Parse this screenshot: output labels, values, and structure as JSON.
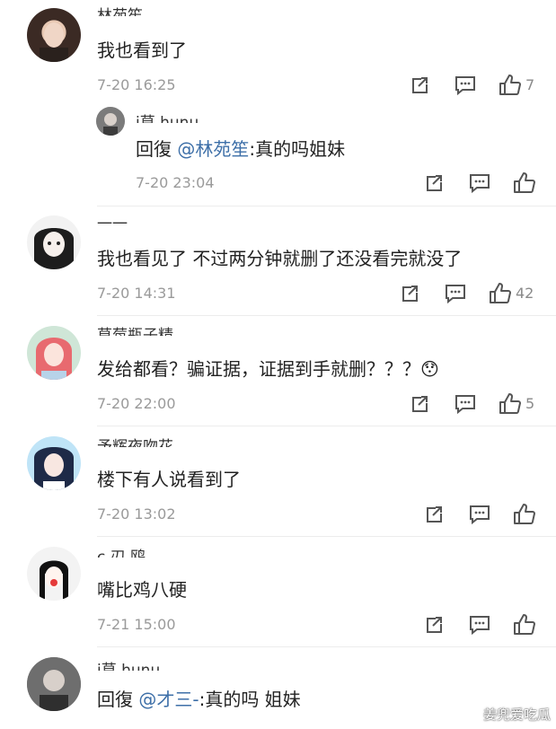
{
  "comments": [
    {
      "name": "林苑笙",
      "text": "我也看到了",
      "time": "7-20 16:25",
      "likes": "7"
    },
    {
      "name": "i草 hunu",
      "reply_prefix": "回復",
      "mention": "@林苑笙",
      "text": ":真的吗姐妹",
      "time": "7-20 23:04",
      "likes": ""
    },
    {
      "name": "一一",
      "text": "我也看见了 不过两分钟就删了还没看完就没了",
      "time": "7-20 14:31",
      "likes": "42"
    },
    {
      "name": "草莓瓶子精",
      "text": "发给都看？骗证据，证据到手就删？？？",
      "emoji": "😯",
      "time": "7-20 22:00",
      "likes": "5"
    },
    {
      "name": "予辉夜吻花",
      "text": "楼下有人说看到了",
      "time": "7-20 13:02",
      "likes": ""
    },
    {
      "name": "c 刃 鸥",
      "text": "嘴比鸡八硬",
      "time": "7-21 15:00",
      "likes": ""
    },
    {
      "name": "i草 hunu",
      "reply_prefix": "回復",
      "mention": "@才三-",
      "text": ":真的吗 姐妹",
      "time": "",
      "likes": ""
    }
  ],
  "watermark": "姜兜爱吃瓜",
  "colors": {
    "mention": "#3d6fa8",
    "time": "#9a9a9a",
    "separator": "#ececec"
  }
}
